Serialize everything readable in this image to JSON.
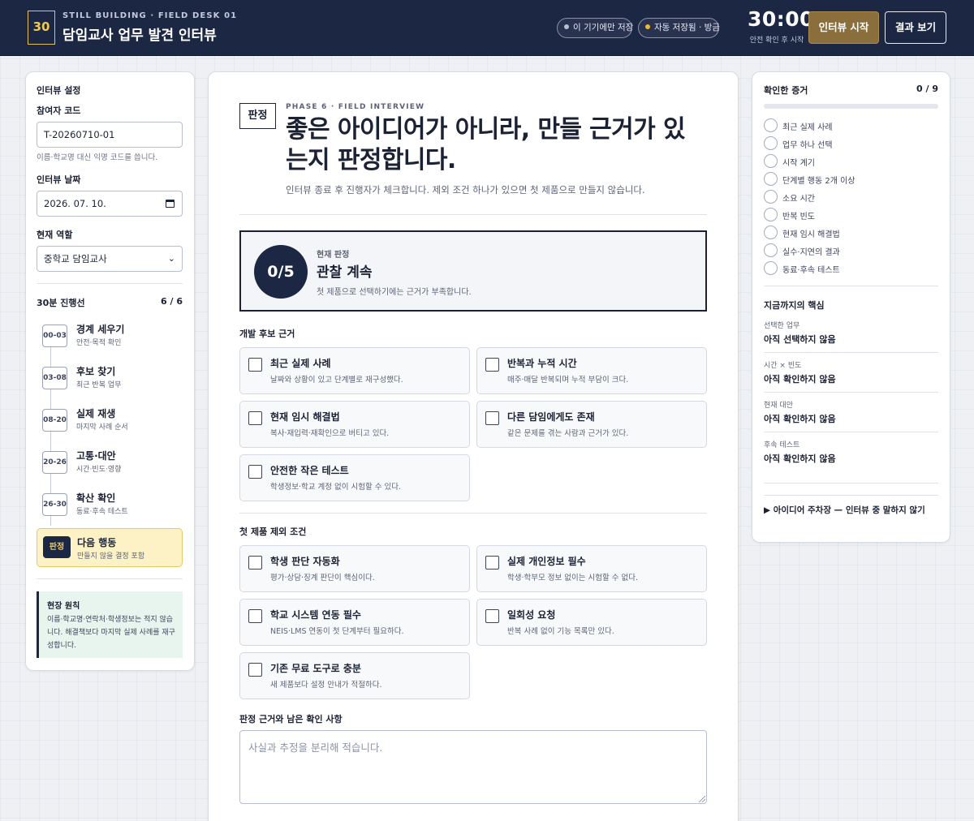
{
  "header": {
    "logo": "30",
    "eyebrow": "STILL BUILDING · FIELD DESK 01",
    "title": "담임교사 업무 발견 인터뷰",
    "pill_local": "이 기기에만 저장",
    "pill_autosave": "자동 저장됨 · 방금",
    "timer": "30:00",
    "timer_caption": "안전 확인 후 시작",
    "start_button": "인터뷰 시작",
    "result_button": "결과 보기"
  },
  "sidebar": {
    "section_title": "인터뷰 설정",
    "participant_label": "참여자 코드",
    "participant_value": "T-20260710-01",
    "participant_hint": "이름·학교명 대신 익명 코드를 씁니다.",
    "date_label": "인터뷰 날짜",
    "date_value": "2026. 07. 10.",
    "role_label": "현재 역할",
    "role_value": "중학교 담임교사",
    "timeline_title": "30분 진행선",
    "timeline_count": "6 / 6",
    "steps": [
      {
        "time": "00-03",
        "title": "경계 세우기",
        "sub": "안전·목적 확인"
      },
      {
        "time": "03-08",
        "title": "후보 찾기",
        "sub": "최근 반복 업무"
      },
      {
        "time": "08-20",
        "title": "실제 재생",
        "sub": "마지막 사례 순서"
      },
      {
        "time": "20-26",
        "title": "고통·대안",
        "sub": "시간·빈도·영향"
      },
      {
        "time": "26-30",
        "title": "확산 확인",
        "sub": "동료·후속 테스트"
      }
    ],
    "active_step": {
      "badge": "판정",
      "title": "다음 행동",
      "sub": "만들지 않을 결정 포함"
    },
    "principle_title": "현장 원칙",
    "principle_body": "이름·학교명·연락처·학생정보는 적지 않습니다. 해결책보다 마지막 실제 사례를 재구성합니다."
  },
  "main": {
    "phase_tag": "판정",
    "eyebrow": "PHASE 6 · FIELD INTERVIEW",
    "headline": "좋은 아이디어가 아니라, 만들 근거가 있는지 판정합니다.",
    "lede": "인터뷰 종료 후 진행자가 체크합니다. 제외 조건 하나가 있으면 첫 제품으로 만들지 않습니다.",
    "verdict": {
      "score": "0/5",
      "label": "현재 판정",
      "status": "관찰 계속",
      "desc": "첫 제품으로 선택하기에는 근거가 부족합니다."
    },
    "dev_title": "개발 후보 근거",
    "dev_cards": [
      {
        "title": "최근 실제 사례",
        "desc": "날짜와 상황이 있고 단계별로 재구성했다."
      },
      {
        "title": "반복과 누적 시간",
        "desc": "매주·매달 반복되며 누적 부담이 크다."
      },
      {
        "title": "현재 임시 해결법",
        "desc": "복사·재입력·재확인으로 버티고 있다."
      },
      {
        "title": "다른 담임에게도 존재",
        "desc": "같은 문제를 겪는 사람과 근거가 있다."
      },
      {
        "title": "안전한 작은 테스트",
        "desc": "학생정보·학교 계정 없이 시험할 수 있다."
      }
    ],
    "excl_title": "첫 제품 제외 조건",
    "excl_cards": [
      {
        "title": "학생 판단 자동화",
        "desc": "평가·상담·징계 판단이 핵심이다."
      },
      {
        "title": "실제 개인정보 필수",
        "desc": "학생·학부모 정보 없이는 시험할 수 없다."
      },
      {
        "title": "학교 시스템 연동 필수",
        "desc": "NEIS·LMS 연동이 첫 단계부터 필요하다."
      },
      {
        "title": "일회성 요청",
        "desc": "반복 사례 없이 기능 목록만 있다."
      },
      {
        "title": "기존 무료 도구로 충분",
        "desc": "새 제품보다 설정 안내가 적절하다."
      }
    ],
    "notes_label": "판정 근거와 남은 확인 사항",
    "notes_placeholder": "사실과 추정을 분리해 적습니다."
  },
  "evidence": {
    "title": "확인한 증거",
    "count": "0 / 9",
    "progress": 0,
    "items": [
      "최근 실제 사례",
      "업무 하나 선택",
      "시작 계기",
      "단계별 행동 2개 이상",
      "소요 시간",
      "반복 빈도",
      "현재 임시 해결법",
      "실수·지연의 결과",
      "동료·후속 테스트"
    ]
  },
  "core": {
    "title": "지금까지의 핵심",
    "rows": [
      {
        "key": "선택한 업무",
        "value": "아직 선택하지 않음"
      },
      {
        "key": "시간 × 빈도",
        "value": "아직 확인하지 않음"
      },
      {
        "key": "현재 대안",
        "value": "아직 확인하지 않음"
      },
      {
        "key": "후속 테스트",
        "value": "아직 확인하지 않음"
      }
    ],
    "parking": "▶ 아이디어 주차장 — 인터뷰 중 말하지 않기"
  }
}
